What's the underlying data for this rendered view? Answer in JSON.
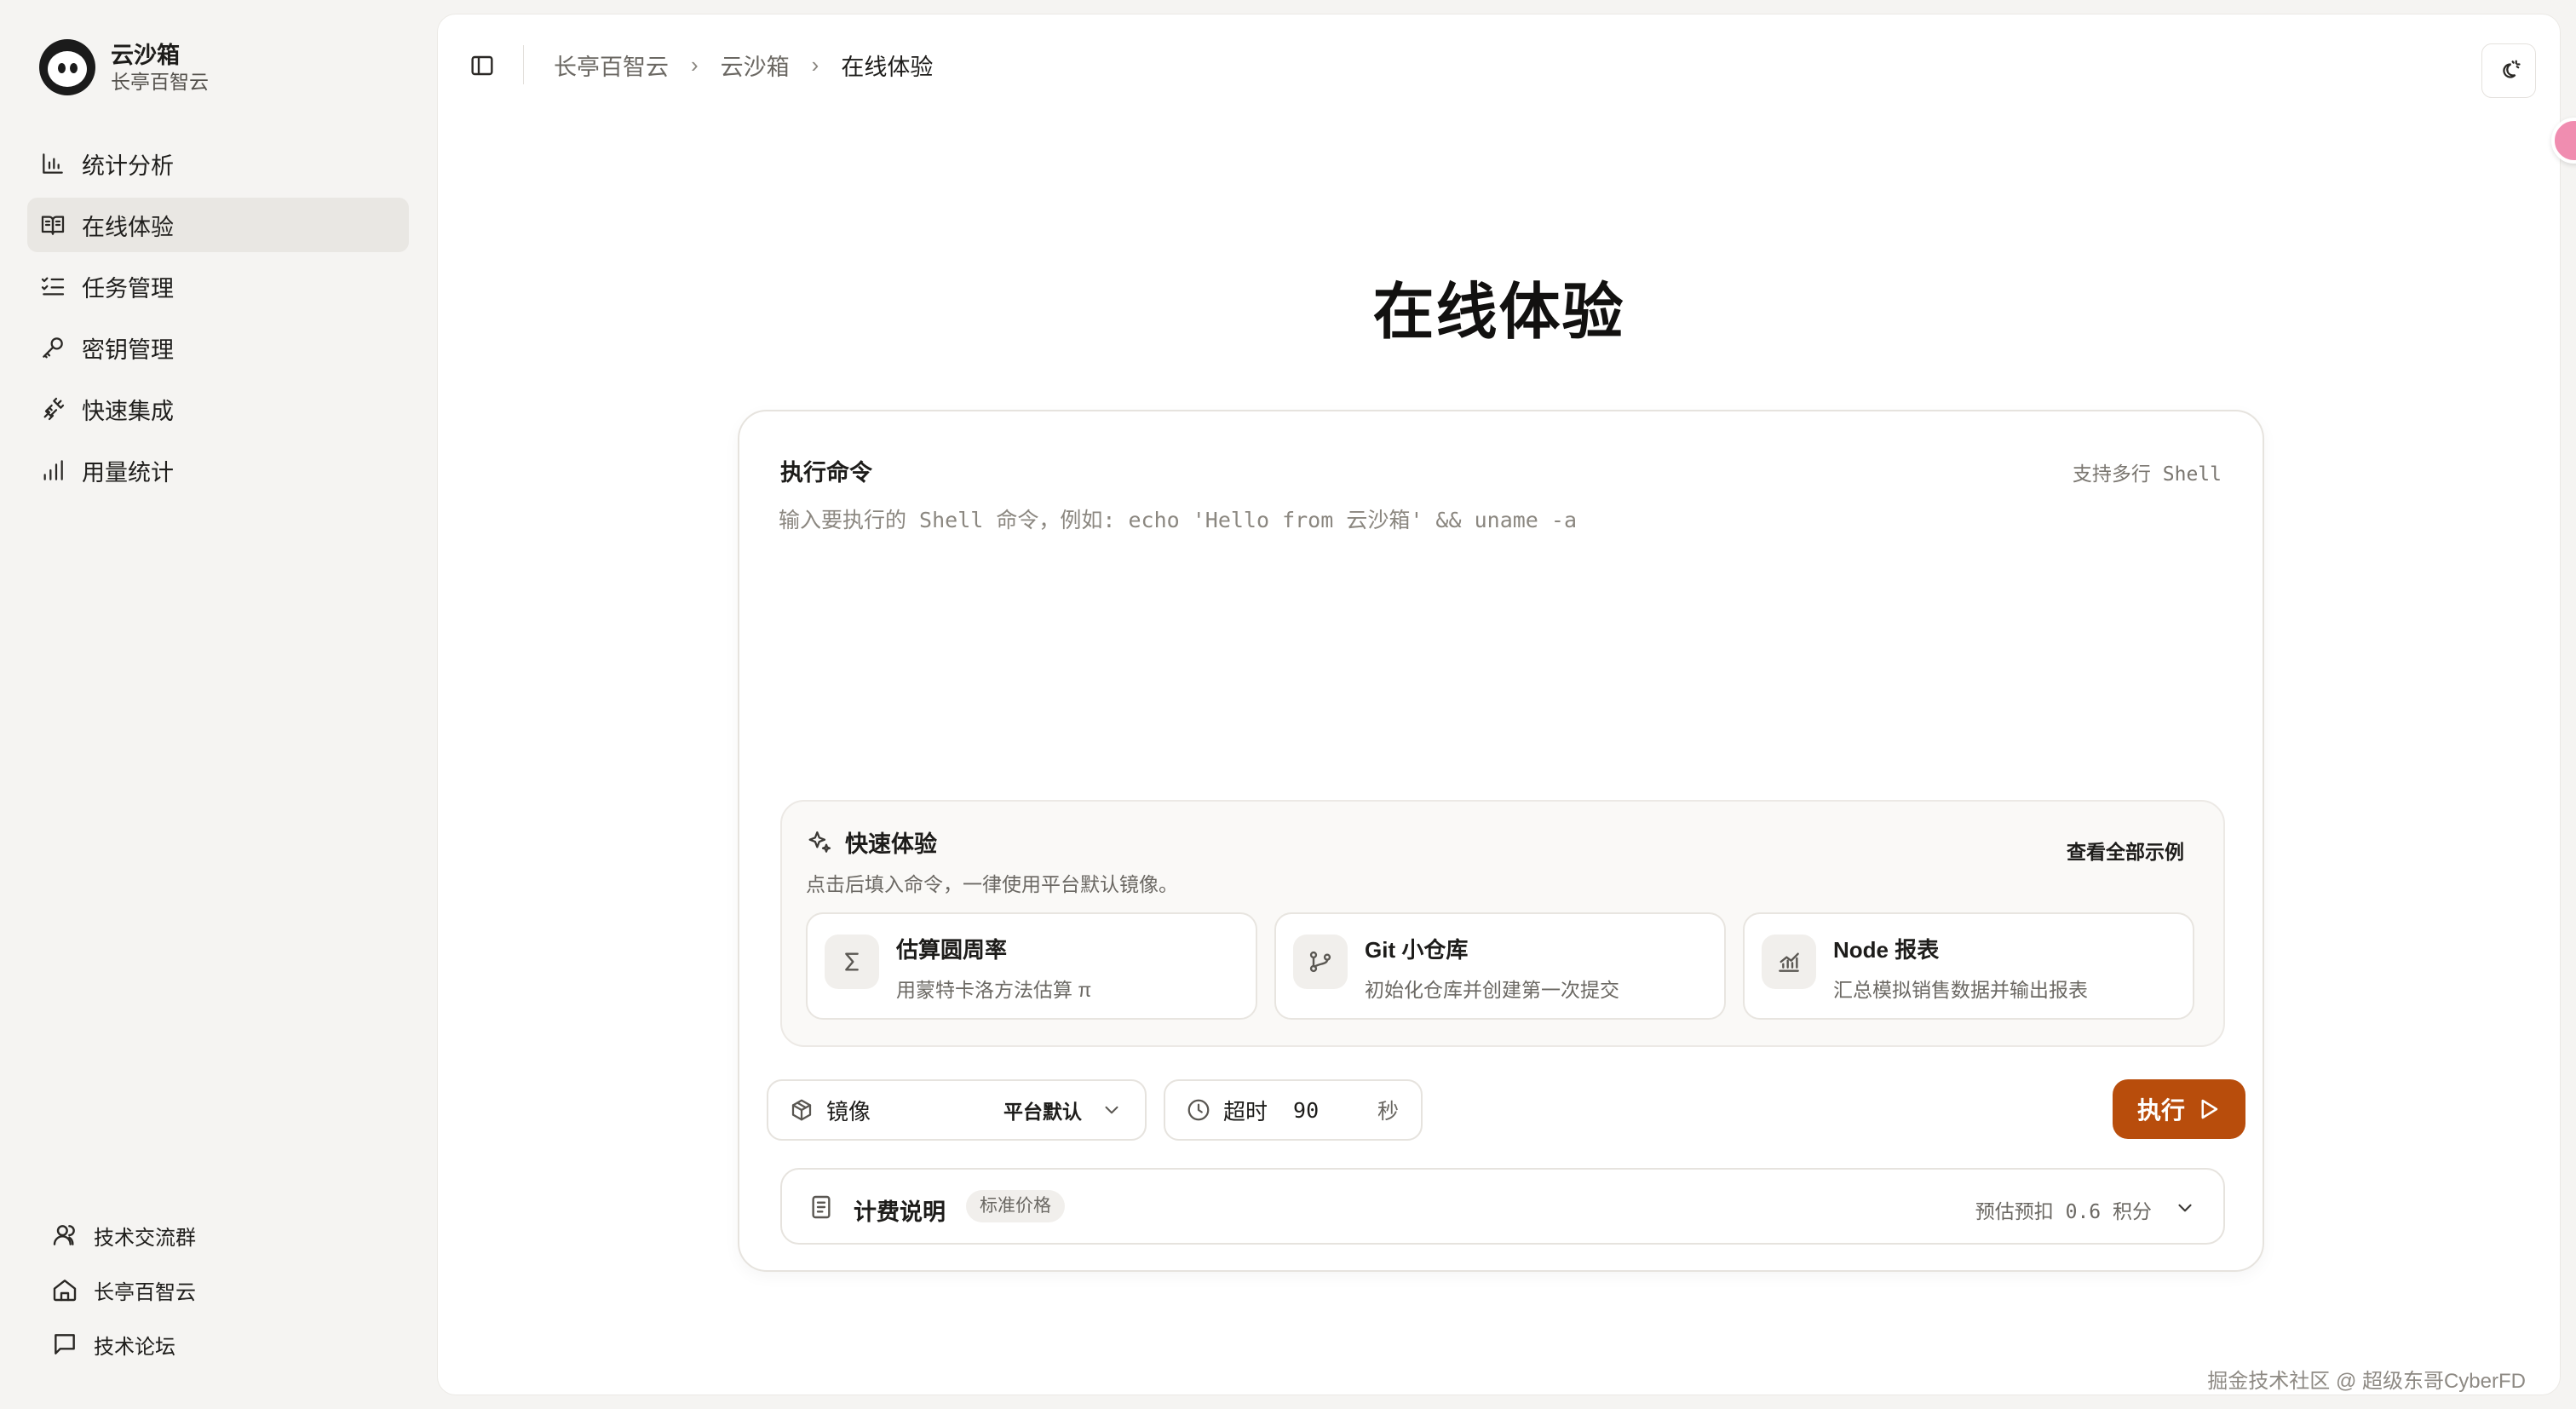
{
  "brand": {
    "title": "云沙箱",
    "subtitle": "长亭百智云"
  },
  "sidebar": {
    "items": [
      {
        "label": "统计分析",
        "icon": "bar-chart-icon"
      },
      {
        "label": "在线体验",
        "icon": "book-open-icon",
        "active": true
      },
      {
        "label": "任务管理",
        "icon": "list-checks-icon"
      },
      {
        "label": "密钥管理",
        "icon": "key-icon"
      },
      {
        "label": "快速集成",
        "icon": "plug-icon"
      },
      {
        "label": "用量统计",
        "icon": "signal-bars-icon"
      }
    ],
    "footer": [
      {
        "label": "技术交流群",
        "icon": "users-icon"
      },
      {
        "label": "长亭百智云",
        "icon": "home-icon"
      },
      {
        "label": "技术论坛",
        "icon": "message-square-icon"
      }
    ]
  },
  "header": {
    "breadcrumb": [
      "长亭百智云",
      "云沙箱",
      "在线体验"
    ],
    "theme_toggle_icon": "sun-moon-icon"
  },
  "main": {
    "title": "在线体验",
    "command": {
      "label": "执行命令",
      "hint": "支持多行 Shell",
      "value": "",
      "placeholder": "输入要执行的 Shell 命令，例如: echo 'Hello from 云沙箱' && uname -a"
    },
    "quick": {
      "title": "快速体验",
      "subtitle": "点击后填入命令，一律使用平台默认镜像。",
      "view_all": "查看全部示例",
      "examples": [
        {
          "title": "估算圆周率",
          "desc": "用蒙特卡洛方法估算 π",
          "icon": "sigma-icon"
        },
        {
          "title": "Git 小仓库",
          "desc": "初始化仓库并创建第一次提交",
          "icon": "git-branch-icon"
        },
        {
          "title": "Node 报表",
          "desc": "汇总模拟销售数据并输出报表",
          "icon": "chart-icon"
        }
      ]
    },
    "controls": {
      "image_label": "镜像",
      "image_value": "平台默认",
      "timeout_label": "超时",
      "timeout_value": "90",
      "timeout_unit": "秒",
      "run_label": "执行"
    },
    "billing": {
      "title": "计费说明",
      "badge": "标准价格",
      "estimate": "预估预扣 0.6 积分"
    }
  },
  "watermark": "掘金技术社区 @ 超级东哥CyberFD",
  "colors": {
    "accent": "#b84d0c",
    "background": "#f5f4f2",
    "panel": "#ffffff"
  }
}
